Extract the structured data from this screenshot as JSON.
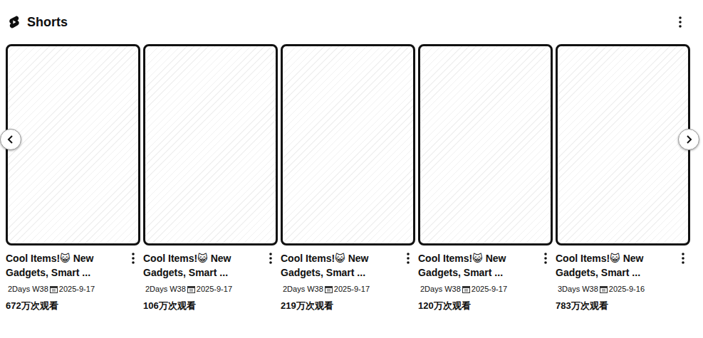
{
  "header": {
    "title": "Shorts"
  },
  "shelf": {
    "items": [
      {
        "title": "Cool Items!😺 New Gadgets, Smart ...",
        "age": "2Days W38",
        "date": "2025-9-17",
        "views": "672万次观看"
      },
      {
        "title": "Cool Items!😺 New Gadgets, Smart ...",
        "age": "2Days W38",
        "date": "2025-9-17",
        "views": "106万次观看"
      },
      {
        "title": "Cool Items!😺 New Gadgets, Smart ...",
        "age": "2Days W38",
        "date": "2025-9-17",
        "views": "219万次观看"
      },
      {
        "title": "Cool Items!😺 New Gadgets, Smart ...",
        "age": "2Days W38",
        "date": "2025-9-17",
        "views": "120万次观看"
      },
      {
        "title": "Cool Items!😺 New Gadgets, Smart ...",
        "age": "3Days W38",
        "date": "2025-9-16",
        "views": "783万次观看"
      }
    ]
  }
}
